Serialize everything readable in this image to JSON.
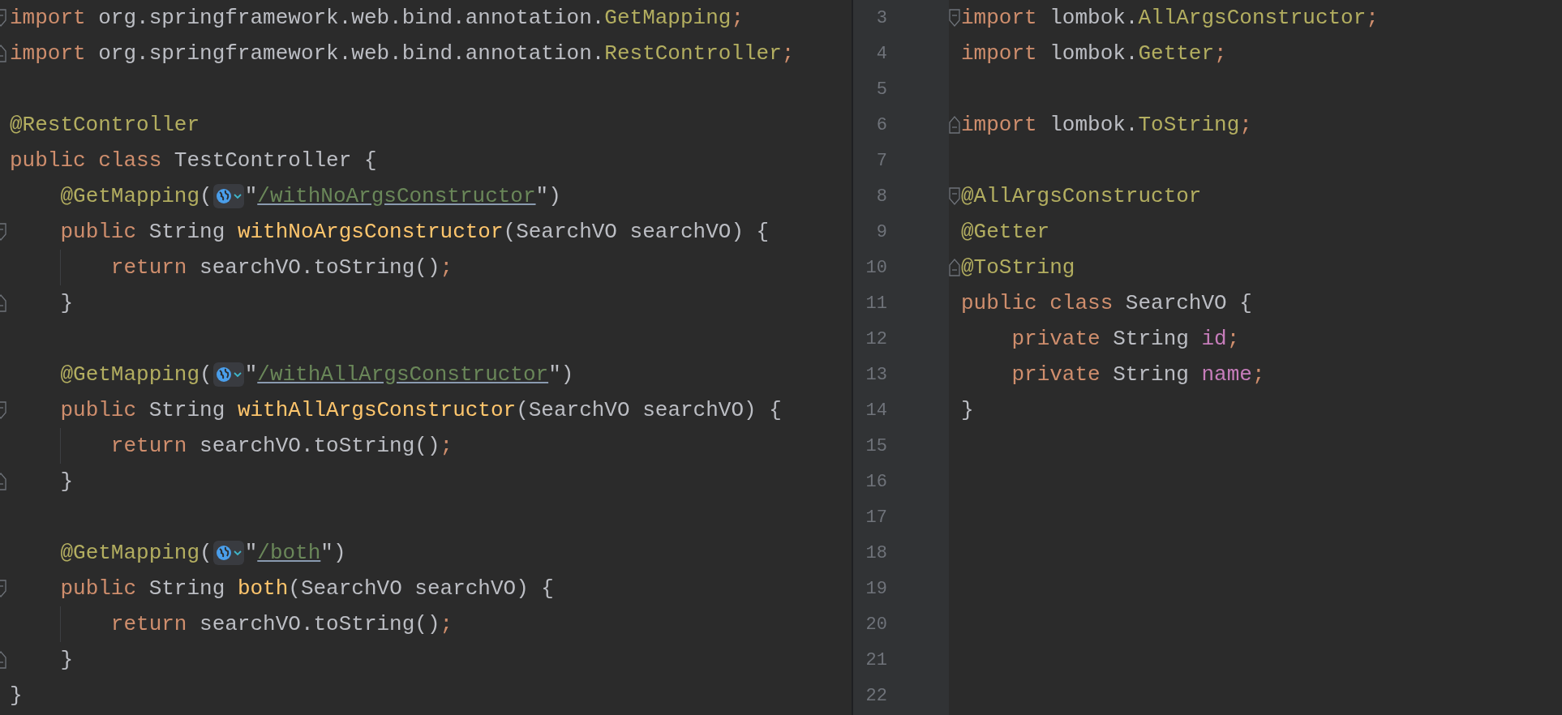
{
  "left_editor": {
    "lines": [
      {
        "fold_start": true,
        "fold_end": false,
        "tokens": [
          {
            "kind": "keyword",
            "text": "import "
          },
          {
            "kind": "plain",
            "text": "org.springframework.web.bind.annotation."
          },
          {
            "kind": "annotation",
            "text": "GetMapping"
          },
          {
            "kind": "punct",
            "text": ";"
          }
        ]
      },
      {
        "fold_start": false,
        "fold_end": true,
        "tokens": [
          {
            "kind": "keyword",
            "text": "import "
          },
          {
            "kind": "plain",
            "text": "org.springframework.web.bind.annotation."
          },
          {
            "kind": "annotation",
            "text": "RestController"
          },
          {
            "kind": "punct",
            "text": ";"
          }
        ]
      },
      {
        "fold_start": false,
        "fold_end": false
      },
      {
        "fold_start": false,
        "fold_end": false,
        "tokens": [
          {
            "kind": "annotation",
            "text": "@RestController"
          }
        ]
      },
      {
        "fold_start": false,
        "fold_end": false,
        "tokens": [
          {
            "kind": "keyword",
            "text": "public class "
          },
          {
            "kind": "plain",
            "text": "TestController {"
          }
        ]
      },
      {
        "fold_start": false,
        "fold_end": false,
        "tokens": [
          {
            "kind": "annotation",
            "text": "    @GetMapping"
          },
          {
            "kind": "plain",
            "text": "("
          },
          {
            "kind": "inlay"
          },
          {
            "kind": "plain",
            "text": "\""
          },
          {
            "kind": "url",
            "text": "/withNoArgsConstructor"
          },
          {
            "kind": "plain",
            "text": "\")"
          }
        ]
      },
      {
        "fold_start": true,
        "fold_end": false,
        "tokens": [
          {
            "kind": "keyword",
            "text": "    public "
          },
          {
            "kind": "plain",
            "text": "String "
          },
          {
            "kind": "method",
            "text": "withNoArgsConstructor"
          },
          {
            "kind": "plain",
            "text": "(SearchVO searchVO) {"
          }
        ]
      },
      {
        "fold_start": false,
        "fold_end": false,
        "tokens": [
          {
            "kind": "keyword",
            "text": "        return "
          },
          {
            "kind": "plain",
            "text": "searchVO.toString()"
          },
          {
            "kind": "punct",
            "text": ";"
          }
        ]
      },
      {
        "fold_start": false,
        "fold_end": true,
        "tokens": [
          {
            "kind": "plain",
            "text": "    }"
          }
        ]
      },
      {
        "fold_start": false,
        "fold_end": false
      },
      {
        "fold_start": false,
        "fold_end": false,
        "tokens": [
          {
            "kind": "annotation",
            "text": "    @GetMapping"
          },
          {
            "kind": "plain",
            "text": "("
          },
          {
            "kind": "inlay"
          },
          {
            "kind": "plain",
            "text": "\""
          },
          {
            "kind": "url",
            "text": "/withAllArgsConstructor"
          },
          {
            "kind": "plain",
            "text": "\")"
          }
        ]
      },
      {
        "fold_start": true,
        "fold_end": false,
        "tokens": [
          {
            "kind": "keyword",
            "text": "    public "
          },
          {
            "kind": "plain",
            "text": "String "
          },
          {
            "kind": "method",
            "text": "withAllArgsConstructor"
          },
          {
            "kind": "plain",
            "text": "(SearchVO searchVO) {"
          }
        ]
      },
      {
        "fold_start": false,
        "fold_end": false,
        "tokens": [
          {
            "kind": "keyword",
            "text": "        return "
          },
          {
            "kind": "plain",
            "text": "searchVO.toString()"
          },
          {
            "kind": "punct",
            "text": ";"
          }
        ]
      },
      {
        "fold_start": false,
        "fold_end": true,
        "tokens": [
          {
            "kind": "plain",
            "text": "    }"
          }
        ]
      },
      {
        "fold_start": false,
        "fold_end": false
      },
      {
        "fold_start": false,
        "fold_end": false,
        "tokens": [
          {
            "kind": "annotation",
            "text": "    @GetMapping"
          },
          {
            "kind": "plain",
            "text": "("
          },
          {
            "kind": "inlay"
          },
          {
            "kind": "plain",
            "text": "\""
          },
          {
            "kind": "url",
            "text": "/both"
          },
          {
            "kind": "plain",
            "text": "\")"
          }
        ]
      },
      {
        "fold_start": true,
        "fold_end": false,
        "tokens": [
          {
            "kind": "keyword",
            "text": "    public "
          },
          {
            "kind": "plain",
            "text": "String "
          },
          {
            "kind": "method",
            "text": "both"
          },
          {
            "kind": "plain",
            "text": "(SearchVO searchVO) {"
          }
        ]
      },
      {
        "fold_start": false,
        "fold_end": false,
        "tokens": [
          {
            "kind": "keyword",
            "text": "        return "
          },
          {
            "kind": "plain",
            "text": "searchVO.toString()"
          },
          {
            "kind": "punct",
            "text": ";"
          }
        ]
      },
      {
        "fold_start": false,
        "fold_end": true,
        "tokens": [
          {
            "kind": "plain",
            "text": "    }"
          }
        ]
      },
      {
        "fold_start": false,
        "fold_end": false,
        "tokens": [
          {
            "kind": "plain",
            "text": "}"
          }
        ]
      }
    ]
  },
  "right_editor": {
    "lines": [
      {
        "number": "3",
        "fold_start": true,
        "fold_end": false,
        "tokens": [
          {
            "kind": "keyword",
            "text": "import "
          },
          {
            "kind": "plain",
            "text": "lombok."
          },
          {
            "kind": "annotation",
            "text": "AllArgsConstructor"
          },
          {
            "kind": "punct",
            "text": ";"
          }
        ]
      },
      {
        "number": "4",
        "fold_start": false,
        "fold_end": false,
        "tokens": [
          {
            "kind": "keyword",
            "text": "import "
          },
          {
            "kind": "plain",
            "text": "lombok."
          },
          {
            "kind": "annotation",
            "text": "Getter"
          },
          {
            "kind": "punct",
            "text": ";"
          }
        ]
      },
      {
        "number": "5",
        "fold_start": false,
        "fold_end": false
      },
      {
        "number": "6",
        "fold_start": false,
        "fold_end": true,
        "tokens": [
          {
            "kind": "keyword",
            "text": "import "
          },
          {
            "kind": "plain",
            "text": "lombok."
          },
          {
            "kind": "annotation",
            "text": "ToString"
          },
          {
            "kind": "punct",
            "text": ";"
          }
        ]
      },
      {
        "number": "7",
        "fold_start": false,
        "fold_end": false
      },
      {
        "number": "8",
        "fold_start": true,
        "fold_end": false,
        "tokens": [
          {
            "kind": "annotation",
            "text": "@AllArgsConstructor"
          }
        ]
      },
      {
        "number": "9",
        "fold_start": false,
        "fold_end": false,
        "tokens": [
          {
            "kind": "annotation",
            "text": "@Getter"
          }
        ]
      },
      {
        "number": "10",
        "fold_start": false,
        "fold_end": true,
        "tokens": [
          {
            "kind": "annotation",
            "text": "@ToString"
          }
        ]
      },
      {
        "number": "11",
        "fold_start": false,
        "fold_end": false,
        "tokens": [
          {
            "kind": "keyword",
            "text": "public class "
          },
          {
            "kind": "plain",
            "text": "SearchVO {"
          }
        ]
      },
      {
        "number": "12",
        "fold_start": false,
        "fold_end": false,
        "tokens": [
          {
            "kind": "keyword",
            "text": "    private "
          },
          {
            "kind": "plain",
            "text": "String "
          },
          {
            "kind": "field",
            "text": "id"
          },
          {
            "kind": "punct",
            "text": ";"
          }
        ]
      },
      {
        "number": "13",
        "fold_start": false,
        "fold_end": false,
        "tokens": [
          {
            "kind": "keyword",
            "text": "    private "
          },
          {
            "kind": "plain",
            "text": "String "
          },
          {
            "kind": "field",
            "text": "name"
          },
          {
            "kind": "punct",
            "text": ";"
          }
        ]
      },
      {
        "number": "14",
        "fold_start": false,
        "fold_end": false,
        "tokens": [
          {
            "kind": "plain",
            "text": "}"
          }
        ]
      },
      {
        "number": "15",
        "fold_start": false,
        "fold_end": false
      },
      {
        "number": "16",
        "fold_start": false,
        "fold_end": false
      },
      {
        "number": "17",
        "fold_start": false,
        "fold_end": false
      },
      {
        "number": "18",
        "fold_start": false,
        "fold_end": false
      },
      {
        "number": "19",
        "fold_start": false,
        "fold_end": false
      },
      {
        "number": "20",
        "fold_start": false,
        "fold_end": false
      },
      {
        "number": "21",
        "fold_start": false,
        "fold_end": false
      },
      {
        "number": "22",
        "fold_start": false,
        "fold_end": false
      }
    ]
  }
}
